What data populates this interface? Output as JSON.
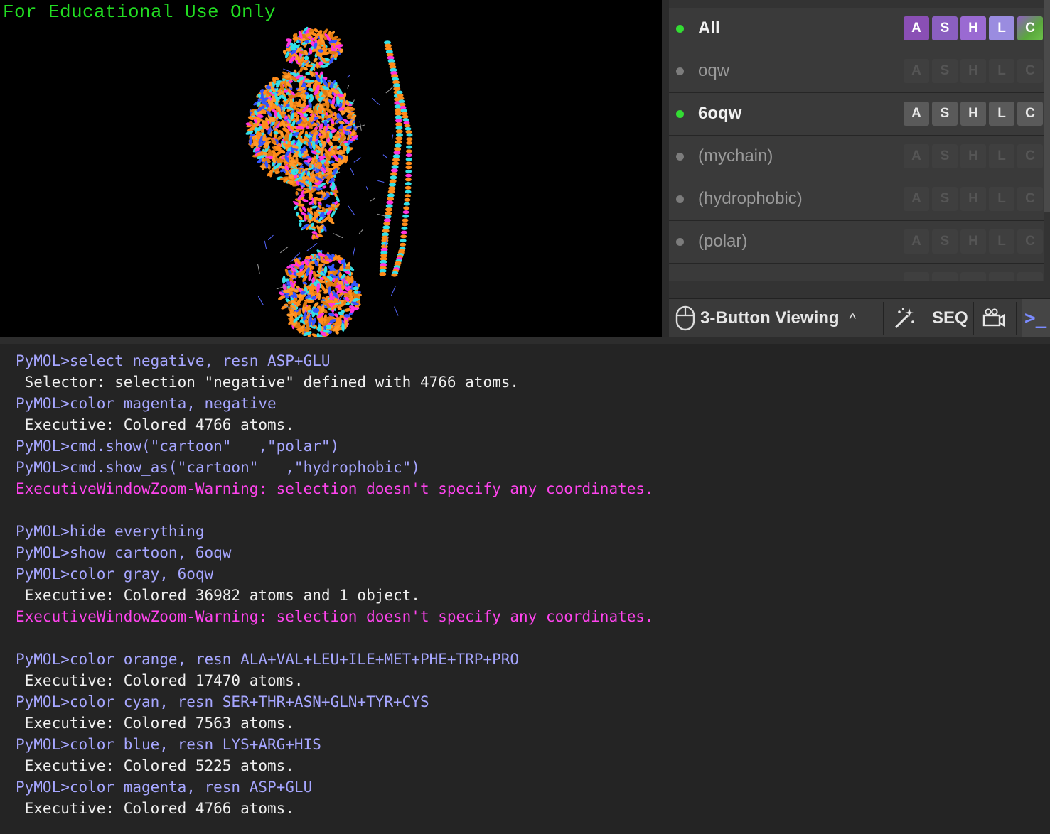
{
  "viewer": {
    "watermark": "For Educational Use Only",
    "background": "#000000"
  },
  "object_panel": {
    "rows": [
      {
        "name": "All",
        "enabled": true,
        "buttons": [
          "A",
          "S",
          "H",
          "L",
          "C"
        ],
        "style": "colored"
      },
      {
        "name": "oqw",
        "enabled": false,
        "buttons": [
          "A",
          "S",
          "H",
          "L",
          "C"
        ],
        "style": "disabled"
      },
      {
        "name": "6oqw",
        "enabled": true,
        "buttons": [
          "A",
          "S",
          "H",
          "L",
          "C"
        ],
        "style": "normal"
      },
      {
        "name": "(mychain)",
        "enabled": false,
        "buttons": [
          "A",
          "S",
          "H",
          "L",
          "C"
        ],
        "style": "disabled"
      },
      {
        "name": "(hydrophobic)",
        "enabled": false,
        "buttons": [
          "A",
          "S",
          "H",
          "L",
          "C"
        ],
        "style": "disabled"
      },
      {
        "name": "(polar)",
        "enabled": false,
        "buttons": [
          "A",
          "S",
          "H",
          "L",
          "C"
        ],
        "style": "disabled"
      }
    ],
    "colors": {
      "enabled_dot": "#33dd33",
      "disabled_dot": "#8a8a8a",
      "btn_A": "#8a4fb5",
      "btn_S": "#8a5fc0",
      "btn_H": "#9a6ad2",
      "btn_L": "#9a8ce0",
      "btn_C": "#66bb44"
    }
  },
  "toolbar": {
    "mouse_mode": "3-Button Viewing",
    "chevron": "^",
    "wand_icon": "magic-wand-icon",
    "seq_label": "SEQ",
    "camera_icon": "movie-camera-icon",
    "console_icon": ">_"
  },
  "console": {
    "lines": [
      {
        "type": "cmd",
        "text": "PyMOL>select negative, resn ASP+GLU"
      },
      {
        "type": "out",
        "text": " Selector: selection \"negative\" defined with 4766 atoms."
      },
      {
        "type": "cmd",
        "text": "PyMOL>color magenta, negative"
      },
      {
        "type": "out",
        "text": " Executive: Colored 4766 atoms."
      },
      {
        "type": "cmd",
        "text": "PyMOL>cmd.show(\"cartoon\"   ,\"polar\")"
      },
      {
        "type": "cmd",
        "text": "PyMOL>cmd.show_as(\"cartoon\"   ,\"hydrophobic\")"
      },
      {
        "type": "warn",
        "text": "ExecutiveWindowZoom-Warning: selection doesn't specify any coordinates."
      },
      {
        "type": "blank",
        "text": ""
      },
      {
        "type": "cmd",
        "text": "PyMOL>hide everything"
      },
      {
        "type": "cmd",
        "text": "PyMOL>show cartoon, 6oqw"
      },
      {
        "type": "cmd",
        "text": "PyMOL>color gray, 6oqw"
      },
      {
        "type": "out",
        "text": " Executive: Colored 36982 atoms and 1 object."
      },
      {
        "type": "warn",
        "text": "ExecutiveWindowZoom-Warning: selection doesn't specify any coordinates."
      },
      {
        "type": "blank",
        "text": ""
      },
      {
        "type": "cmd",
        "text": "PyMOL>color orange, resn ALA+VAL+LEU+ILE+MET+PHE+TRP+PRO"
      },
      {
        "type": "out",
        "text": " Executive: Colored 17470 atoms."
      },
      {
        "type": "cmd",
        "text": "PyMOL>color cyan, resn SER+THR+ASN+GLN+TYR+CYS"
      },
      {
        "type": "out",
        "text": " Executive: Colored 7563 atoms."
      },
      {
        "type": "cmd",
        "text": "PyMOL>color blue, resn LYS+ARG+HIS"
      },
      {
        "type": "out",
        "text": " Executive: Colored 5225 atoms."
      },
      {
        "type": "cmd",
        "text": "PyMOL>color magenta, resn ASP+GLU"
      },
      {
        "type": "out",
        "text": " Executive: Colored 4766 atoms."
      }
    ]
  }
}
